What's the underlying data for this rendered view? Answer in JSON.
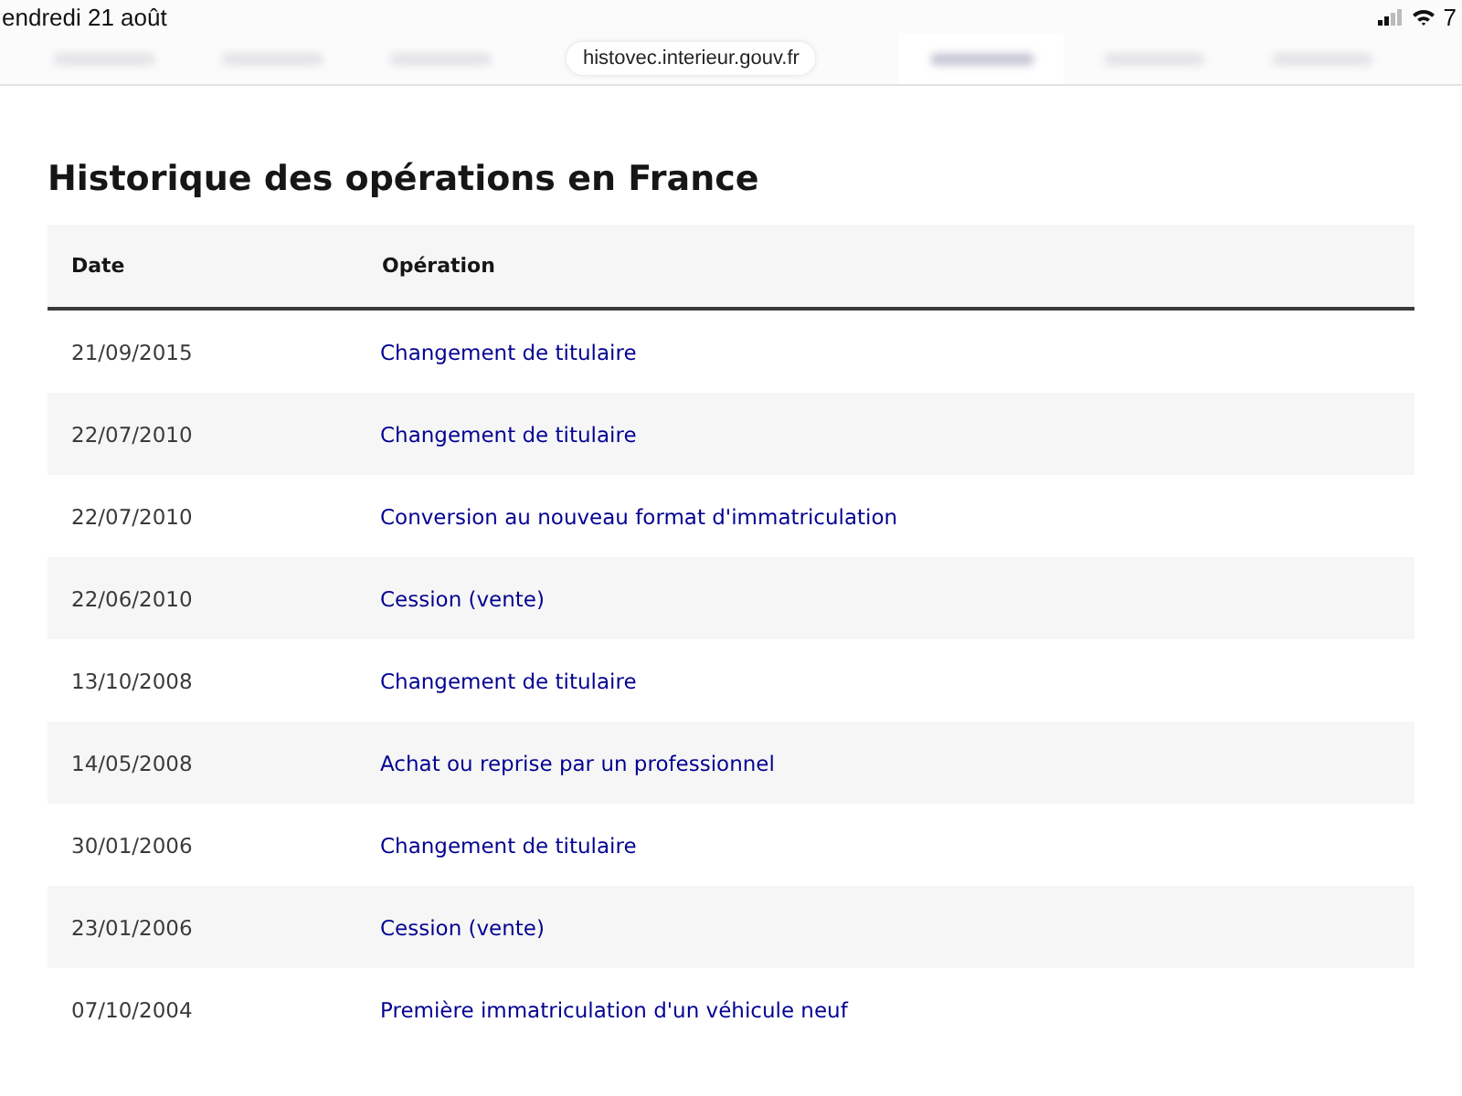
{
  "status_bar": {
    "date": "endredi 21 août",
    "battery": "7"
  },
  "url": "histovec.interieur.gouv.fr",
  "tabs": [
    {
      "selected": false
    },
    {
      "selected": false
    },
    {
      "selected": false
    },
    {
      "selected": true
    },
    {
      "selected": false
    },
    {
      "selected": false
    }
  ],
  "title": "Historique des opérations en France",
  "table": {
    "columns": [
      "Date",
      "Opération"
    ],
    "rows": [
      {
        "date": "21/09/2015",
        "operation": "Changement de titulaire"
      },
      {
        "date": "22/07/2010",
        "operation": "Changement de titulaire"
      },
      {
        "date": "22/07/2010",
        "operation": "Conversion au nouveau format d'immatriculation"
      },
      {
        "date": "22/06/2010",
        "operation": "Cession (vente)"
      },
      {
        "date": "13/10/2008",
        "operation": "Changement de titulaire"
      },
      {
        "date": "14/05/2008",
        "operation": "Achat ou reprise par un professionnel"
      },
      {
        "date": "30/01/2006",
        "operation": "Changement de titulaire"
      },
      {
        "date": "23/01/2006",
        "operation": "Cession (vente)"
      },
      {
        "date": "07/10/2004",
        "operation": "Première immatriculation d'un véhicule neuf"
      }
    ]
  }
}
